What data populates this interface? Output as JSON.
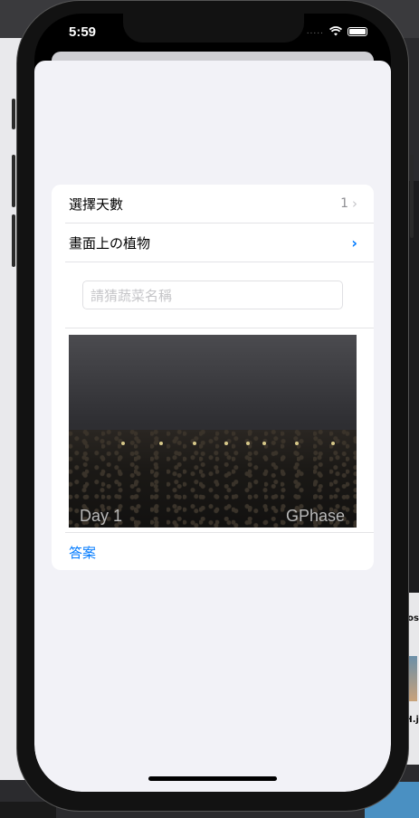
{
  "status_bar": {
    "time": "5:59",
    "signal": "....."
  },
  "form": {
    "rows": [
      {
        "label": "選擇天數",
        "value": "1"
      },
      {
        "label": "畫面上の植物",
        "value": ""
      }
    ],
    "input_placeholder": "請猜蔬菜名稱",
    "image": {
      "left_caption": "Day 1",
      "right_caption": "GPhase"
    },
    "answer_label": "答案"
  },
  "background": {
    "right_text_1": "os",
    "right_text_2": "H.j"
  },
  "colors": {
    "accent": "#007aff",
    "sheet": "#f2f2f7",
    "card": "#ffffff"
  }
}
